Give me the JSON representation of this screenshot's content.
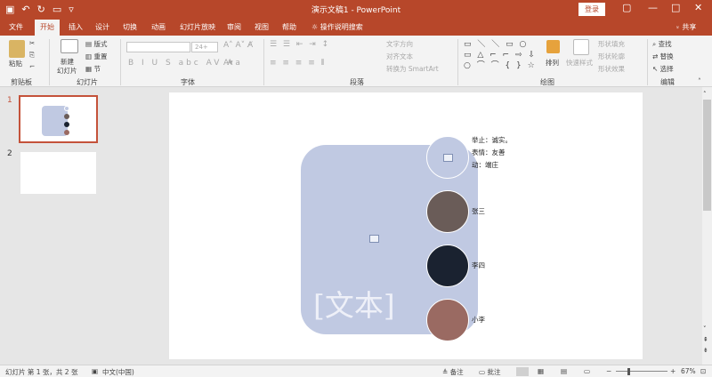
{
  "app": {
    "title": "演示文稿1 - PowerPoint",
    "login": "登录",
    "share": "共享",
    "tell_me": "操作说明搜索"
  },
  "tabs": [
    "文件",
    "开始",
    "插入",
    "设计",
    "切换",
    "动画",
    "幻灯片放映",
    "审阅",
    "视图",
    "帮助"
  ],
  "active_tab": "开始",
  "ribbon": {
    "clipboard": {
      "label": "剪贴板",
      "paste": "粘贴"
    },
    "slides": {
      "label": "幻灯片",
      "new_slide_1": "新建",
      "new_slide_2": "幻灯片",
      "layout": "版式",
      "reset": "重置",
      "section": "节"
    },
    "font": {
      "label": "字体",
      "size_value": "24+"
    },
    "paragraph": {
      "label": "段落",
      "text_direction": "文字方向",
      "align_text": "对齐文本",
      "smartart": "转换为 SmartArt"
    },
    "drawing": {
      "label": "绘图",
      "arrange": "排列",
      "quick_styles": "快速样式",
      "shape_fill": "形状填充",
      "shape_outline": "形状轮廓",
      "shape_effects": "形状效果"
    },
    "editing": {
      "label": "编辑",
      "find": "查找",
      "replace": "替换",
      "select": "选择"
    }
  },
  "slides_pane": {
    "slide_numbers": [
      "1",
      "2"
    ],
    "selected": 1
  },
  "slide": {
    "placeholder_text": "[文本]",
    "info_lines": [
      "举止：诚实。",
      "表情：友善",
      "动：端庄"
    ],
    "people": [
      {
        "name": "张三",
        "color": "#6a5c58"
      },
      {
        "name": "李四",
        "color": "#1a2230"
      },
      {
        "name": "小李",
        "color": "#9a6a62"
      }
    ]
  },
  "status": {
    "slide_info": "幻灯片 第 1 张，共 2 张",
    "language": "中文(中国)",
    "notes": "备注",
    "comments": "批注",
    "zoom": "67%"
  },
  "colors": {
    "accent": "#b7472a",
    "shape_fill": "#c0c9e2"
  }
}
